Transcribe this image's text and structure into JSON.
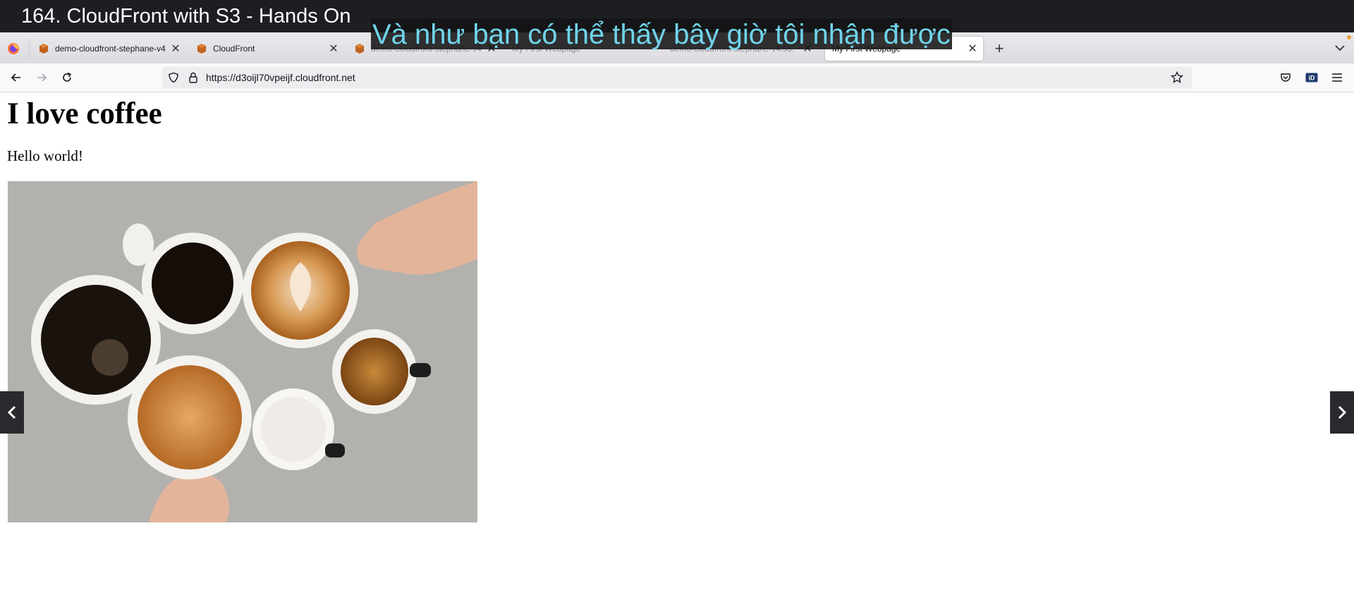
{
  "video": {
    "title": "164. CloudFront with S3 - Hands On",
    "subtitle": "Và như bạn có thể thấy bây giờ tôi nhận được"
  },
  "browser": {
    "tabs": [
      {
        "label": "demo-cloudfront-stephane-v4",
        "favicon": "s3-bucket-icon",
        "close": "✕",
        "state": "normal"
      },
      {
        "label": "CloudFront",
        "favicon": "s3-bucket-icon",
        "close": "✕",
        "state": "normal"
      },
      {
        "label": "demo-cloudfront-stephane-v4",
        "favicon": "s3-bucket-icon",
        "close": "✕",
        "state": "faded"
      },
      {
        "label": "My First Webpage",
        "favicon": "",
        "close": "",
        "state": "faded"
      },
      {
        "label": "demo-cloudfront-stephane-v4.s3.",
        "favicon": "",
        "close": "✕",
        "state": "faded"
      },
      {
        "label": "My First Webpage",
        "favicon": "",
        "close": "✕",
        "state": "active"
      }
    ],
    "new_tab_label": "+",
    "url": "https://d3oijl70vpeijf.cloudfront.net"
  },
  "page": {
    "heading": "I love coffee",
    "paragraph": "Hello world!"
  },
  "colors": {
    "title_bar": "#1c1e22",
    "subtitle_text": "#6fd4ea",
    "tab_strip": "#e9e9ed",
    "aws_orange": "#c0631f"
  }
}
